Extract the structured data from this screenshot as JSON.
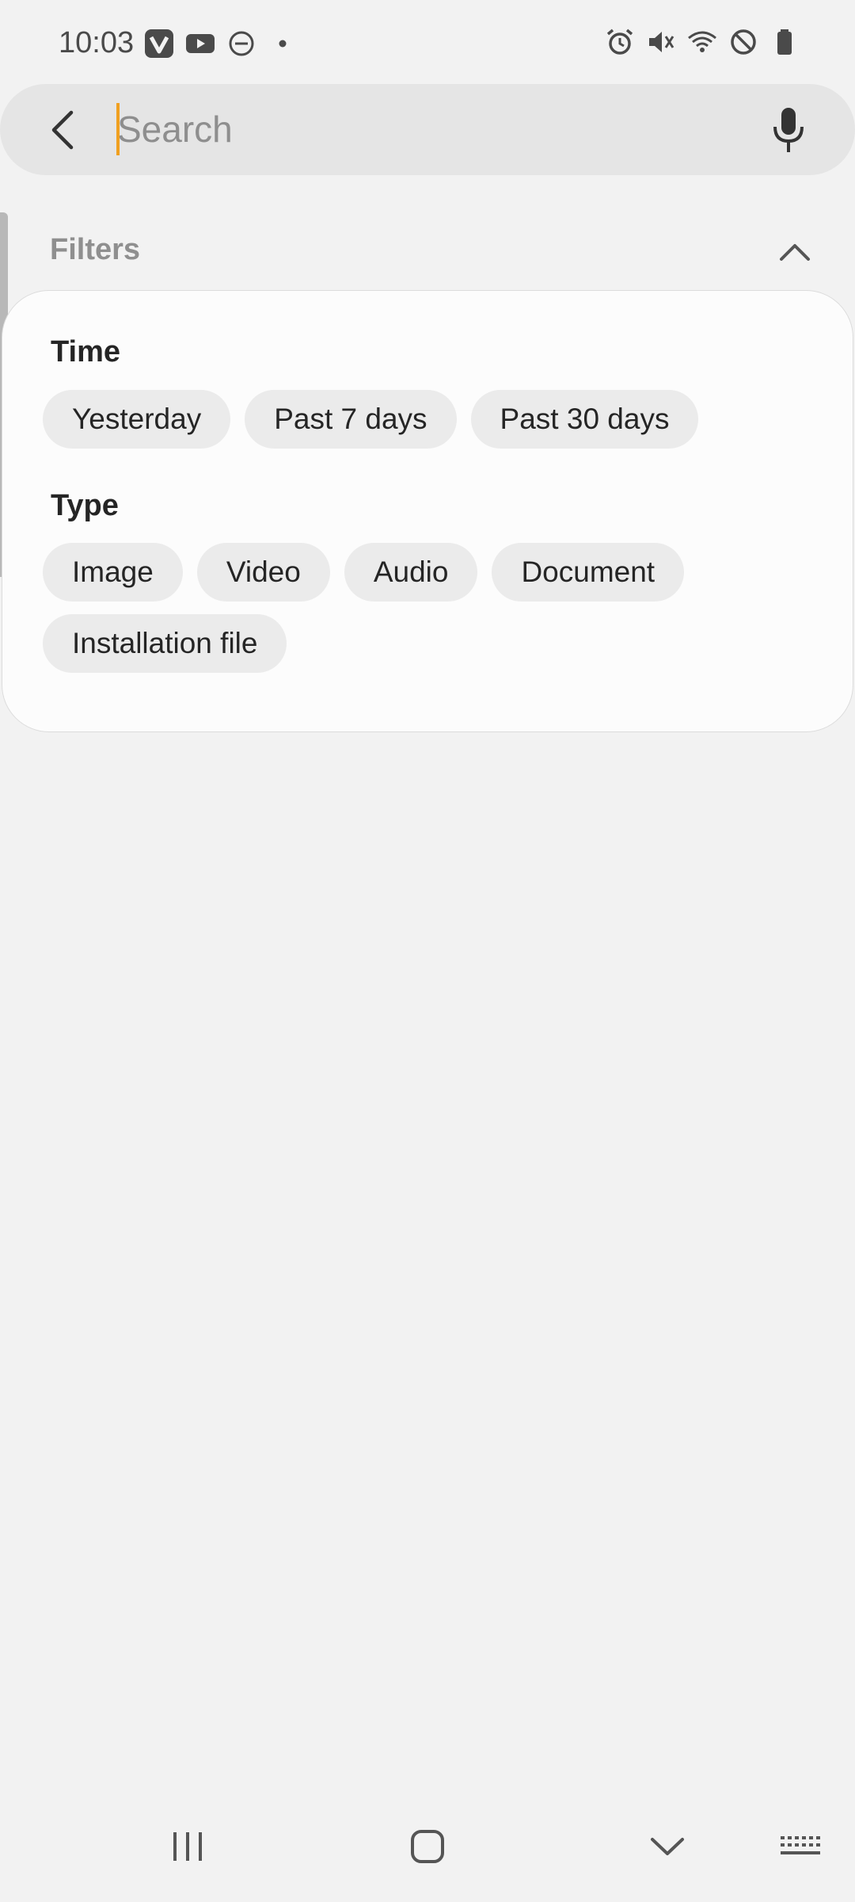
{
  "status_bar": {
    "time": "10:03",
    "left_icons": [
      "vivaldi-app-icon",
      "youtube-icon",
      "do-not-disturb-icon",
      "notification-dot-icon"
    ],
    "right_icons": [
      "alarm-icon",
      "mute-icon",
      "wifi-icon",
      "blocked-icon",
      "battery-icon"
    ]
  },
  "search": {
    "placeholder": "Search",
    "value": ""
  },
  "filters": {
    "title": "Filters",
    "expanded": true,
    "time": {
      "label": "Time",
      "options": [
        "Yesterday",
        "Past 7 days",
        "Past 30 days"
      ]
    },
    "type": {
      "label": "Type",
      "options_row1": [
        "Image",
        "Video",
        "Audio",
        "Document"
      ],
      "options_row2": [
        "Installation file"
      ]
    }
  },
  "nav_bar": {
    "buttons": [
      "recents-icon",
      "home-icon",
      "hide-keyboard-icon",
      "keyboard-icon"
    ]
  },
  "colors": {
    "background": "#f2f2f2",
    "card": "#fcfcfc",
    "chip": "#ebebeb",
    "cursor_accent": "#f0a020",
    "search_bar": "#e5e5e5"
  }
}
